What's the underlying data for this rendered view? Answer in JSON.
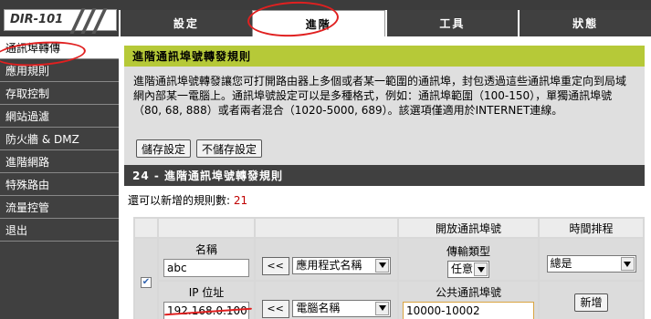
{
  "logo": "DIR-101",
  "tabs": [
    {
      "label": "設定"
    },
    {
      "label": "進階"
    },
    {
      "label": "工具"
    },
    {
      "label": "狀態"
    }
  ],
  "sidebar": {
    "items": [
      {
        "label": "通訊埠轉傳"
      },
      {
        "label": "應用規則"
      },
      {
        "label": "存取控制"
      },
      {
        "label": "網站過濾"
      },
      {
        "label": "防火牆 & DMZ"
      },
      {
        "label": "進階網路"
      },
      {
        "label": "特殊路由"
      },
      {
        "label": "流量控管"
      },
      {
        "label": "退出"
      }
    ]
  },
  "panel1": {
    "title": "進階通訊埠號轉發規則",
    "description": "進階通訊埠號轉發讓您可打開路由器上多個或者某一範圍的通訊埠，封包透過這些通訊埠重定向到局域網內部某一電腦上。通訊埠號設定可以是多種格式，例如：通訊埠範圍（100-150），單獨通訊埠號（80, 68, 888）或者兩者混合（1020-5000, 689）。該選項僅適用於INTERNET連線。",
    "save_label": "儲存設定",
    "nosave_label": "不儲存設定"
  },
  "panel2": {
    "title": "24 - 進階通訊埠號轉發規則",
    "remain_label": "還可以新增的規則數: ",
    "remain_count": "21"
  },
  "table": {
    "header_ports": "開放通訊埠號",
    "header_schedule": "時間排程",
    "name_label": "名稱",
    "name_value": "abc",
    "ip_label": "IP 位址",
    "ip_value": "192.168.0.100",
    "arrow_label": "<<",
    "app_select": "應用程式名稱",
    "pc_select": "電腦名稱",
    "type_label": "傳輸類型",
    "type_value": "任意",
    "public_label": "公共通訊埠號",
    "public_value": "10000-10002",
    "schedule_value": "總是",
    "add_label": "新增"
  },
  "colors": {
    "accent_green": "#b6c938",
    "dark_bg": "#404040",
    "annotation_red": "#e02020"
  }
}
